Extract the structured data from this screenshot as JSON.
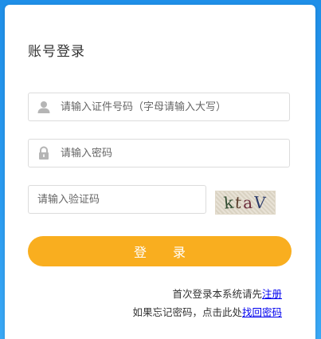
{
  "login": {
    "title": "账号登录",
    "id_placeholder": "请输入证件号码（字母请输入大写）",
    "password_placeholder": "请输入密码",
    "captcha_placeholder": "请输入验证码",
    "captcha_chars": [
      "k",
      "t",
      "a",
      "V"
    ],
    "submit_label": "登 录",
    "first_login_text": "首次登录本系统请先",
    "register_link": "注册",
    "forgot_text": "如果忘记密码，点击此处",
    "retrieve_link": "找回密码"
  },
  "colors": {
    "background": "#2a9bf0",
    "button": "#f9ae1f",
    "link": "#0000ee"
  },
  "icons": {
    "id_field": "user-icon",
    "password_field": "lock-icon"
  }
}
